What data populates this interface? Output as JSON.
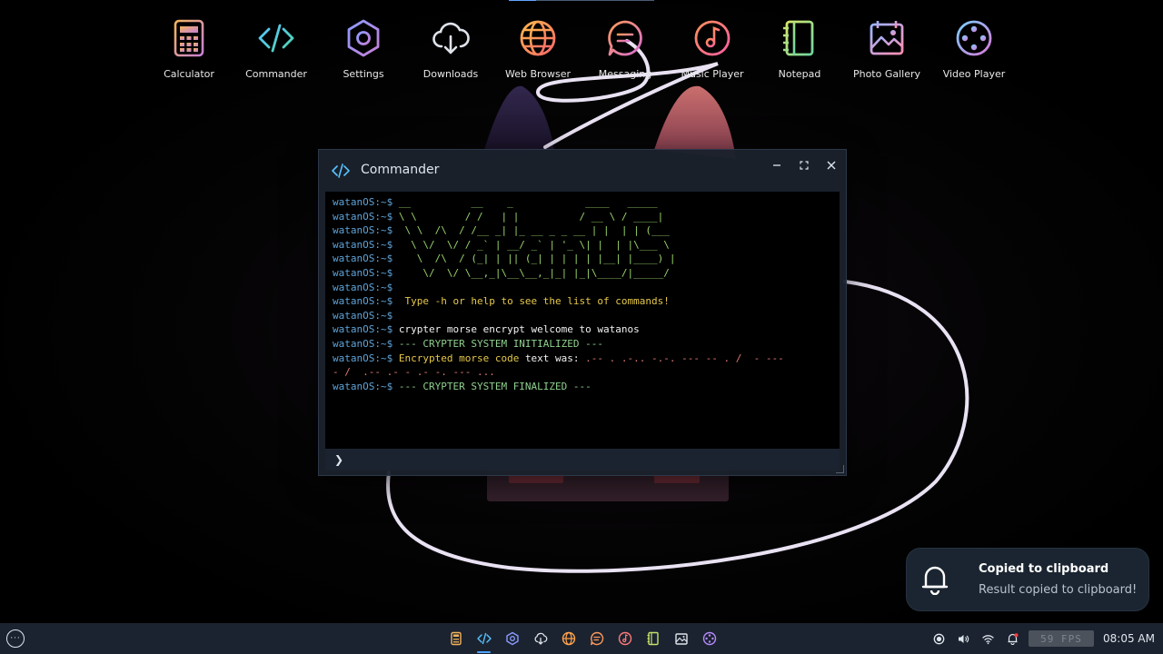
{
  "desktop_icons": [
    {
      "label": "Calculator",
      "icon": "calculator-icon"
    },
    {
      "label": "Commander",
      "icon": "code-icon"
    },
    {
      "label": "Settings",
      "icon": "hexagon-settings-icon"
    },
    {
      "label": "Downloads",
      "icon": "cloud-download-icon"
    },
    {
      "label": "Web Browser",
      "icon": "globe-icon"
    },
    {
      "label": "Messaging",
      "icon": "chat-bubble-icon"
    },
    {
      "label": "Music Player",
      "icon": "music-disc-icon"
    },
    {
      "label": "Notepad",
      "icon": "notepad-icon"
    },
    {
      "label": "Photo Gallery",
      "icon": "photo-gallery-icon"
    },
    {
      "label": "Video Player",
      "icon": "film-reel-icon"
    }
  ],
  "window": {
    "title": "Commander",
    "icon": "code-icon",
    "controls": {
      "minimize": "minimize-icon",
      "maximize": "maximize-icon",
      "close": "close-icon"
    }
  },
  "terminal": {
    "prompt": "watanOS:~$",
    "ascii_art": [
      "__          __    _            ____   _____ ",
      "\\ \\        / /   | |          / __ \\ / ____|",
      " \\ \\  /\\  / /__ _| |_ __ _ _ __ | |  | | (___  ",
      "  \\ \\/  \\/ / _` | __/ _` | '_ \\| |  | |\\___ \\ ",
      "   \\  /\\  / (_| | || (_| | | | | |__| |____) |",
      "    \\/  \\/ \\__,_|\\__\\__,_|_| |_|\\____/|_____/ "
    ],
    "help_text": "Type -h or help to see the list of commands!",
    "command": "crypter morse encrypt welcome to watanos",
    "init_message": "--- CRYPTER SYSTEM INITIALIZED ---",
    "encrypted_label": "Encrypted morse code",
    "encrypted_word": "text was:",
    "morse_output": ".-- . .-.. -.-. --- -- . /  - ---",
    "morse_output_wrap": "- /  .-- .- - .- -. --- ...",
    "final_message": "--- CRYPTER SYSTEM FINALIZED ---",
    "input_value": ""
  },
  "notification": {
    "title": "Copied to clipboard",
    "body": "Result copied to clipboard!",
    "icon": "bell-icon"
  },
  "taskbar": {
    "menu_icon": "more-options-icon",
    "active_app": "Commander",
    "tray": {
      "icons": [
        "record-icon",
        "volume-icon",
        "wifi-icon",
        "notification-bell-icon"
      ],
      "fps": "59 FPS",
      "clock": "08:05 AM"
    }
  },
  "colors": {
    "accent": "#4ea3ff",
    "prompt": "#5fa3d8",
    "ascii": "#9ad46b",
    "help": "#e6c84a",
    "system_message": "#8fd08e",
    "morse": "#e07b73"
  }
}
